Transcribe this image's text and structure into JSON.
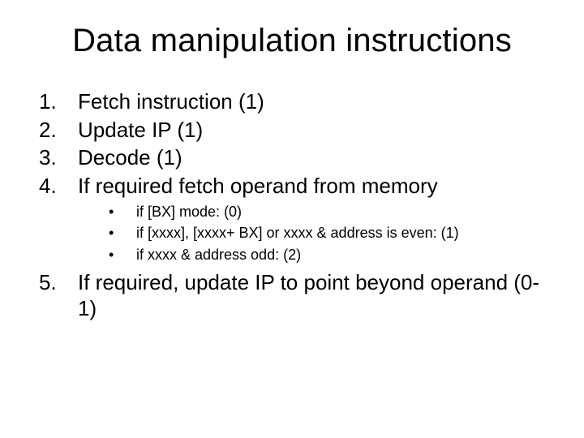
{
  "title": "Data manipulation instructions",
  "items": [
    {
      "num": "1.",
      "text": "Fetch instruction (1)"
    },
    {
      "num": "2.",
      "text": "Update IP (1)"
    },
    {
      "num": "3.",
      "text": "Decode (1)"
    },
    {
      "num": "4.",
      "text": "If required fetch operand from memory"
    }
  ],
  "subitems": [
    {
      "bullet": "•",
      "text": "if [BX] mode: (0)"
    },
    {
      "bullet": "•",
      "text": "if [xxxx], [xxxx+ BX] or xxxx & address is even: (1)"
    },
    {
      "bullet": "•",
      "text": "if xxxx & address odd: (2)"
    }
  ],
  "item5": {
    "num": "5.",
    "text": "If required, update IP to point beyond operand (0-1)"
  }
}
